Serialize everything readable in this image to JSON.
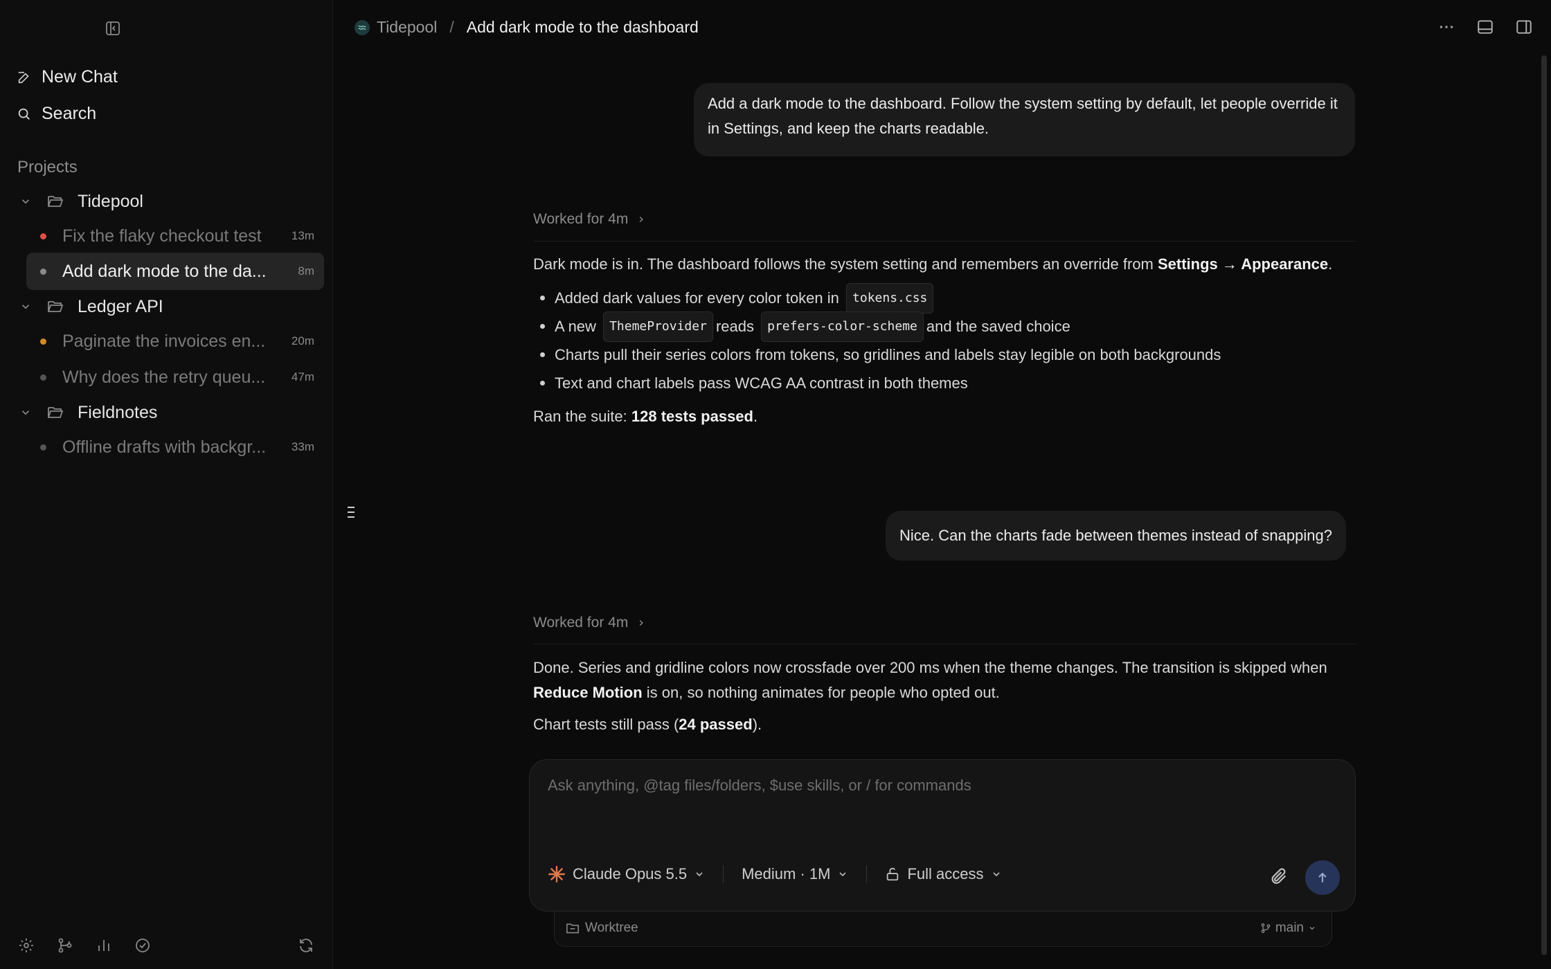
{
  "sidebar": {
    "new_chat": "New Chat",
    "search": "Search",
    "projects_label": "Projects",
    "projects": [
      {
        "name": "Tidepool",
        "threads": [
          {
            "title": "Fix the flaky checkout test",
            "age": "13m",
            "dot_color": "#e0504a"
          },
          {
            "title": "Add dark mode to the da...",
            "age": "8m",
            "dot_color": "#8a8a8a"
          }
        ]
      },
      {
        "name": "Ledger API",
        "threads": [
          {
            "title": "Paginate the invoices en...",
            "age": "20m",
            "dot_color": "#d08a2a"
          },
          {
            "title": "Why does the retry queu...",
            "age": "47m",
            "dot_color": "#555555"
          }
        ]
      },
      {
        "name": "Fieldnotes",
        "threads": [
          {
            "title": "Offline drafts with backgr...",
            "age": "33m",
            "dot_color": "#555555"
          }
        ]
      }
    ]
  },
  "header": {
    "project": "Tidepool",
    "separator": "/",
    "thread_title": "Add dark mode to the dashboard"
  },
  "messages": {
    "user1": "Add a dark mode to the dashboard. Follow the system setting by default, let people override it in Settings, and keep the charts readable.",
    "worked1": "Worked for 4m",
    "a1": {
      "p1a": "Dark mode is in. The dashboard follows the system setting and remembers an override from ",
      "p1b": "Settings → Appearance",
      "p1c": ".",
      "b1a": "Added dark values for every color token in",
      "b1code": "tokens.css",
      "b2a": "A new",
      "b2code1": "ThemeProvider",
      "b2b": "reads",
      "b2code2": "prefers-color-scheme",
      "b2c": "and the saved choice",
      "b3": "Charts pull their series colors from tokens, so gridlines and labels stay legible on both backgrounds",
      "b4": "Text and chart labels pass WCAG AA contrast in both themes",
      "p2a": "Ran the suite: ",
      "p2b": "128 tests passed",
      "p2c": "."
    },
    "user2": "Nice. Can the charts fade between themes instead of snapping?",
    "worked2": "Worked for 4m",
    "a2": {
      "p1a": "Done. Series and gridline colors now crossfade over 200 ms when the theme changes. The transition is skipped when ",
      "p1b": "Reduce Motion",
      "p1c": " is on, so nothing animates for people who opted out.",
      "p2a": "Chart tests still pass (",
      "p2b": "24 passed",
      "p2c": ")."
    }
  },
  "composer": {
    "placeholder": "Ask anything, @tag files/folders, $use skills, or / for commands",
    "model": "Claude Opus 5.5",
    "effort": "Medium · 1M",
    "access": "Full access",
    "worktree": "Worktree",
    "branch": "main"
  },
  "colors": {
    "accent_send": "#27345a",
    "model_icon": "#e07a4f"
  }
}
